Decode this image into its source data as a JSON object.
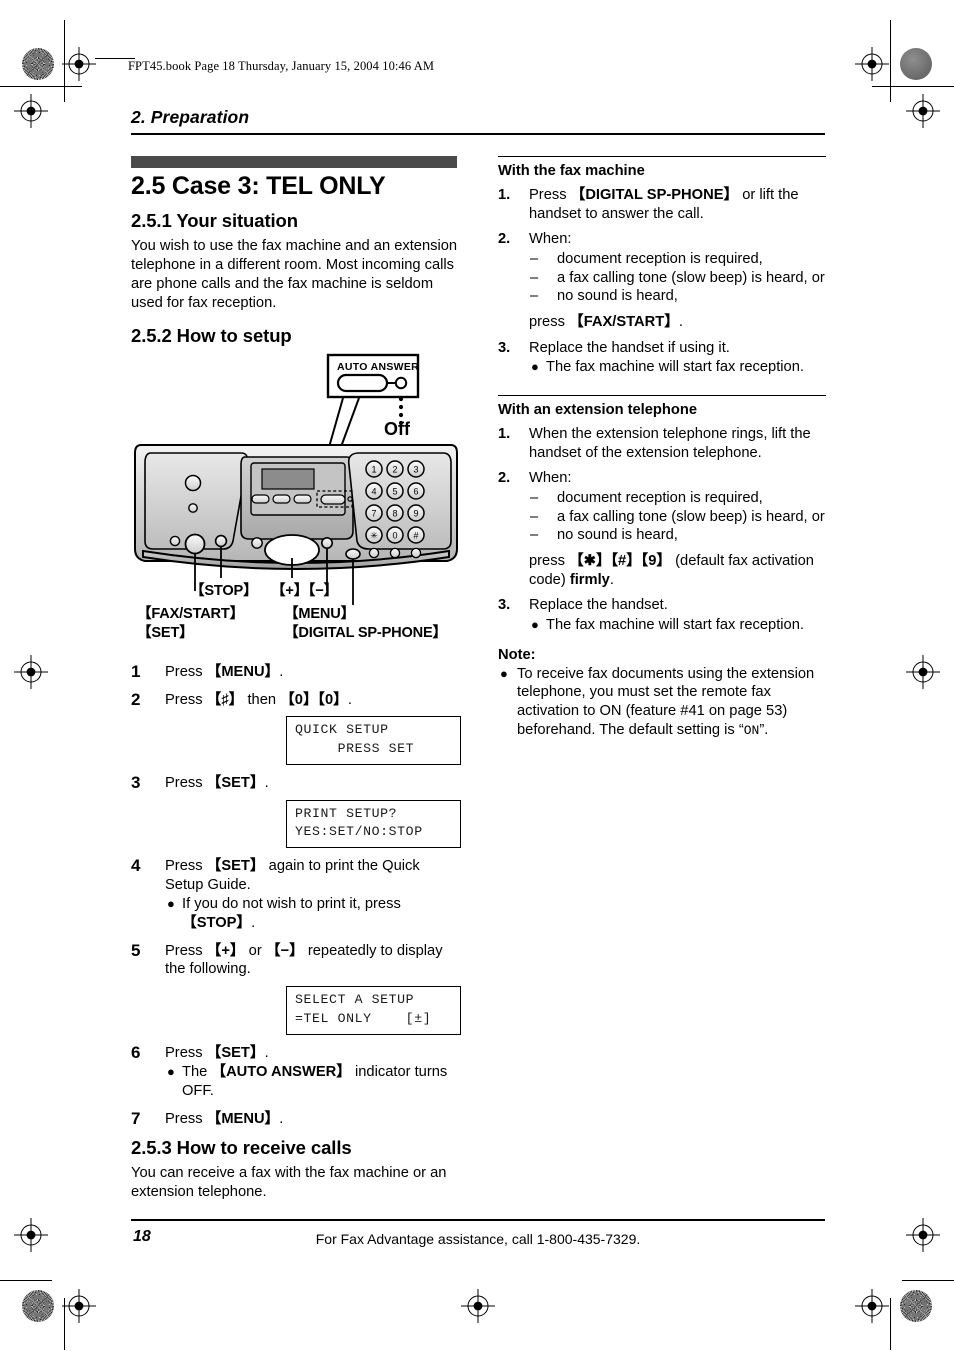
{
  "header": {
    "file_line": "FPT45.book  Page 18  Thursday, January 15, 2004  10:46 AM",
    "chapter": "2. Preparation"
  },
  "left_column": {
    "section_title": "2.5 Case 3: TEL ONLY",
    "sub_1": {
      "title": "2.5.1 Your situation",
      "body": "You wish to use the fax machine and an extension telephone in a different room. Most incoming calls are phone calls and the fax machine is seldom used for fax reception."
    },
    "sub_2": {
      "title": "2.5.2 How to setup"
    },
    "illustration": {
      "callout_title": "AUTO  ANSWER",
      "callout_state": "Off",
      "keypad": [
        "1",
        "2",
        "3",
        "4",
        "5",
        "6",
        "7",
        "8",
        "9",
        "✱",
        "0",
        "#"
      ],
      "labels": {
        "stop": "【STOP】",
        "plusminus": "【+】【−】",
        "faxstart": "【FAX/START】",
        "set": "【SET】",
        "menu": "【MENU】",
        "digital_sp_phone": "【DIGITAL SP-PHONE】"
      }
    },
    "steps": [
      {
        "num": "1",
        "html_parts": [
          {
            "t": "Press "
          },
          {
            "t": "【MENU】",
            "b": true
          },
          {
            "t": "."
          }
        ]
      },
      {
        "num": "2",
        "html_parts": [
          {
            "t": "Press "
          },
          {
            "t": "【♯】",
            "b": true
          },
          {
            "t": " then "
          },
          {
            "t": "【0】【0】",
            "b": true
          },
          {
            "t": "."
          }
        ]
      },
      {
        "num": "3",
        "html_parts": [
          {
            "t": "Press "
          },
          {
            "t": "【SET】",
            "b": true
          },
          {
            "t": "."
          }
        ]
      },
      {
        "num": "4",
        "html_parts": [
          {
            "t": "Press "
          },
          {
            "t": "【SET】",
            "b": true
          },
          {
            "t": " again to print the Quick Setup Guide."
          }
        ]
      },
      {
        "num": "5",
        "html_parts": [
          {
            "t": "Press "
          },
          {
            "t": "【+】",
            "b": true
          },
          {
            "t": " or "
          },
          {
            "t": "【−】",
            "b": true
          },
          {
            "t": " repeatedly to display the following."
          }
        ]
      },
      {
        "num": "6",
        "html_parts": [
          {
            "t": "Press "
          },
          {
            "t": "【SET】",
            "b": true
          },
          {
            "t": "."
          }
        ]
      },
      {
        "num": "7",
        "html_parts": [
          {
            "t": "Press "
          },
          {
            "t": "【MENU】",
            "b": true
          },
          {
            "t": "."
          }
        ]
      }
    ],
    "step4_bullet_pre": "If you do not wish to print it, press ",
    "step4_bullet_key": "【STOP】",
    "step4_bullet_post": ".",
    "step6_bullet_pre": "The ",
    "step6_bullet_key": "【AUTO ANSWER】",
    "step6_bullet_post": " indicator turns OFF.",
    "lcd_1_line1": "QUICK SETUP",
    "lcd_1_line2": "     PRESS SET",
    "lcd_2_line1": "PRINT SETUP?",
    "lcd_2_line2": "YES:SET/NO:STOP",
    "lcd_3_line1": "SELECT A SETUP",
    "lcd_3_line2": "=TEL ONLY    [±]",
    "sub_3": {
      "title": "2.5.3 How to receive calls",
      "body": "You can receive a fax with the fax machine or an extension telephone."
    }
  },
  "right_column": {
    "block_1": {
      "heading": "With the fax machine",
      "step1_pre": "Press ",
      "step1_key": "【DIGITAL SP-PHONE】",
      "step1_post": " or lift the handset to answer the call.",
      "step2_lead": "When:",
      "step2_dashes": [
        "document reception is required,",
        "a fax calling tone (slow beep) is heard, or",
        "no sound is heard,"
      ],
      "step2_tail_pre": "press ",
      "step2_tail_key": "【FAX/START】",
      "step2_tail_post": ".",
      "step3": "Replace the handset if using it.",
      "step3_bullet": "The fax machine will start fax reception."
    },
    "block_2": {
      "heading": "With an extension telephone",
      "step1": "When the extension telephone rings, lift the handset of the extension telephone.",
      "step2_lead": "When:",
      "step2_dashes": [
        "document reception is required,",
        "a fax calling tone (slow beep) is heard, or",
        "no sound is heard,"
      ],
      "step2_tail_pre": "press ",
      "step2_tail_key": "【✱】【#】【9】",
      "step2_tail_mid": " (default fax activation code) ",
      "step2_tail_bold": "firmly",
      "step2_tail_post": ".",
      "step3": "Replace the handset.",
      "step3_bullet": "The fax machine will start fax reception."
    },
    "note": {
      "title": "Note:",
      "text_pre": "To receive fax documents using the extension telephone, you must set the remote fax activation to ON (feature #41 on page 53) beforehand. The default setting is “",
      "text_mono": "ON",
      "text_post": "”."
    }
  },
  "footer": {
    "page_number": "18",
    "text": "For Fax Advantage assistance, call 1-800-435-7329."
  },
  "colors": {
    "band": "#4a4a4a",
    "text": "#000000",
    "lcd_text": "#1a1a1a"
  }
}
